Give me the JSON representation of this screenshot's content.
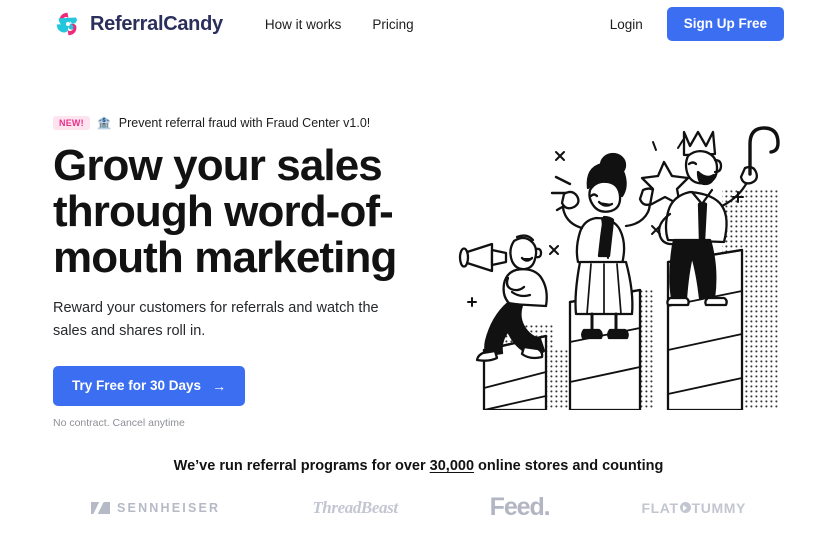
{
  "header": {
    "brand_name": "ReferralCandy",
    "brand_logo_icon": "referralcandy-swirl-logo",
    "nav": [
      {
        "label": "How it works"
      },
      {
        "label": "Pricing"
      }
    ],
    "login_label": "Login",
    "signup_label": "Sign Up Free"
  },
  "hero": {
    "announcement": {
      "badge": "NEW!",
      "emoji": "🏦",
      "emoji_name": "bank-icon",
      "text": "Prevent referral fraud with Fraud Center v1.0!"
    },
    "title": "Grow your sales through word-of-mouth marketing",
    "subtitle": "Reward your customers for referrals and watch the sales and shares roll in.",
    "cta_label": "Try Free for 30 Days",
    "cta_arrow": "→",
    "cta_note": "No contract. Cancel anytime",
    "illustration_name": "people-on-ascending-bar-chart-podiums"
  },
  "proof": {
    "headline_before": "We’ve run referral programs for over ",
    "headline_number": "30,000",
    "headline_after": " online stores and counting",
    "logos": [
      {
        "name": "SENNHEISER"
      },
      {
        "name": "ThreadBeast"
      },
      {
        "name": "Feed."
      },
      {
        "name": "FLAT TUMMY",
        "part1": "FLAT",
        "part2": "TUMMY"
      }
    ]
  },
  "colors": {
    "accent_blue": "#3b6ef0",
    "brand_navy": "#2b2f5c",
    "badge_bg": "#fde4ef",
    "badge_text": "#e8318a",
    "logo_gray": "#b9bdc8",
    "logo_cyan": "#22c7de",
    "logo_pink": "#ee2a7b"
  }
}
